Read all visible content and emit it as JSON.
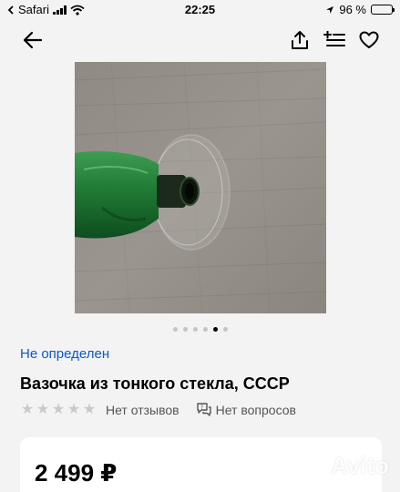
{
  "status_bar": {
    "carrier": "Safari",
    "time": "22:25",
    "battery_percent": "96 %",
    "battery_level": 0.96
  },
  "nav": {
    "back_icon": "arrow-left-icon",
    "share_icon": "share-icon",
    "compare_icon": "add-to-list-icon",
    "favorite_icon": "heart-icon"
  },
  "gallery": {
    "photo_count": 6,
    "active_index": 4
  },
  "listing": {
    "seller_status": "Не определен",
    "title": "Вазочка из тонкого стекла, СССР",
    "reviews": "Нет отзывов",
    "questions": "Нет вопросов",
    "rating_stars": 5
  },
  "price": {
    "value": "2 499 ₽"
  },
  "watermark": {
    "text": "Avito"
  },
  "colors": {
    "accent": "#0a57d0",
    "background": "#f3f3f3"
  }
}
